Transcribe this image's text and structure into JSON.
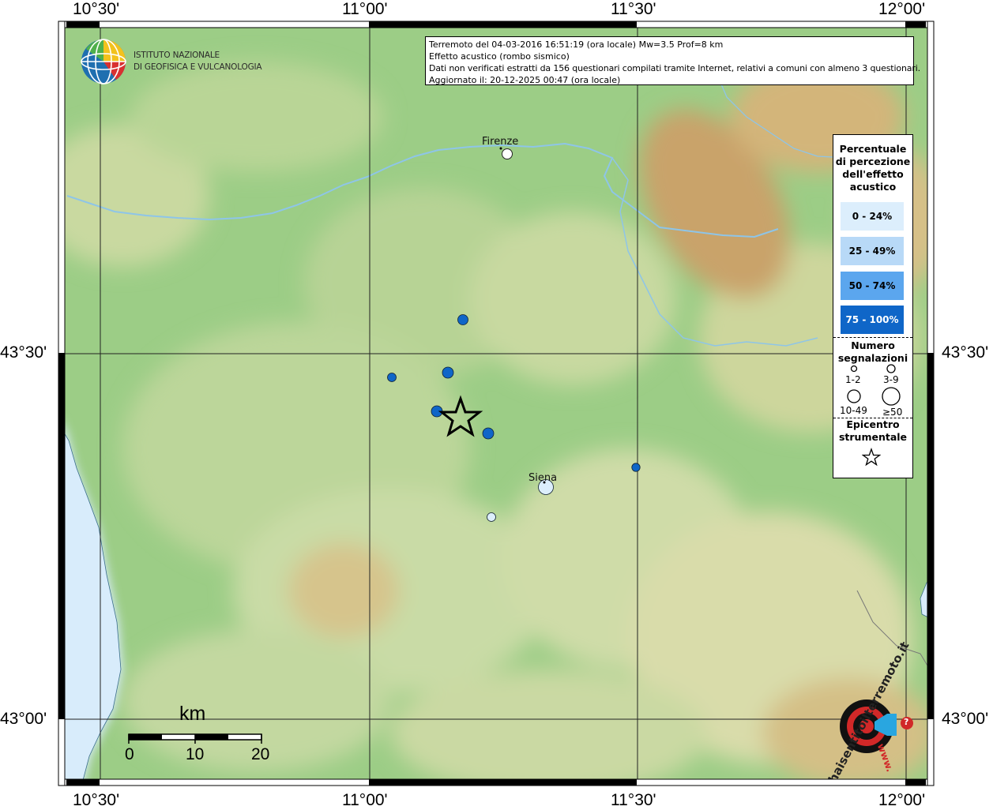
{
  "axes": {
    "lon_top": [
      "10°30'",
      "11°00'",
      "11°30'",
      "12°00'"
    ],
    "lon_bottom": [
      "10°30'",
      "11°00'",
      "11°30'",
      "12°00'"
    ],
    "lat_left": [
      "43°30'",
      "43°00'"
    ],
    "lat_right": [
      "43°30'",
      "43°00'"
    ]
  },
  "info": {
    "line1": "Terremoto del 04-03-2016 16:51:19 (ora locale) Mw=3.5 Prof=8 km",
    "line2": "Effetto acustico (rombo sismico)",
    "line3": "Dati non verificati estratti da 156 questionari compilati tramite Internet, relativi a comuni con almeno 3 questionari.",
    "line4": "Aggiornato il: 20-12-2025 00:47 (ora locale)"
  },
  "logo": {
    "line1": "ISTITUTO NAZIONALE",
    "line2": "DI GEOFISICA E VULCANOLOGIA"
  },
  "cities": [
    {
      "name": "Firenze"
    },
    {
      "name": "Siena"
    }
  ],
  "legend": {
    "title_lines": [
      "Percentuale",
      "di percezione",
      "dell'effetto",
      "acustico"
    ],
    "bins": [
      {
        "label": "0 - 24%",
        "color": "#dceefc"
      },
      {
        "label": "25 - 49%",
        "color": "#b8d9f7"
      },
      {
        "label": "50 - 74%",
        "color": "#5ba6ee"
      },
      {
        "label": "75 - 100%",
        "color": "#0f66c8"
      }
    ],
    "count_title_lines": [
      "Numero",
      "segnalazioni"
    ],
    "counts": [
      "1-2",
      "3-9",
      "10-49",
      "≥50"
    ],
    "epicenter_title_lines": [
      "Epicentro",
      "strumentale"
    ]
  },
  "scale": {
    "title": "km",
    "labels": [
      "0",
      "10",
      "20"
    ]
  },
  "brand": {
    "text": "haisentitoilterremoto.it",
    "url": "www.",
    "question": "?"
  },
  "colors": {
    "lowland": "#8fc77f",
    "hills": "#c9d79a",
    "mountains": "#c9a36a",
    "sea": "#d8ecfb",
    "river": "#8ec5e8"
  }
}
